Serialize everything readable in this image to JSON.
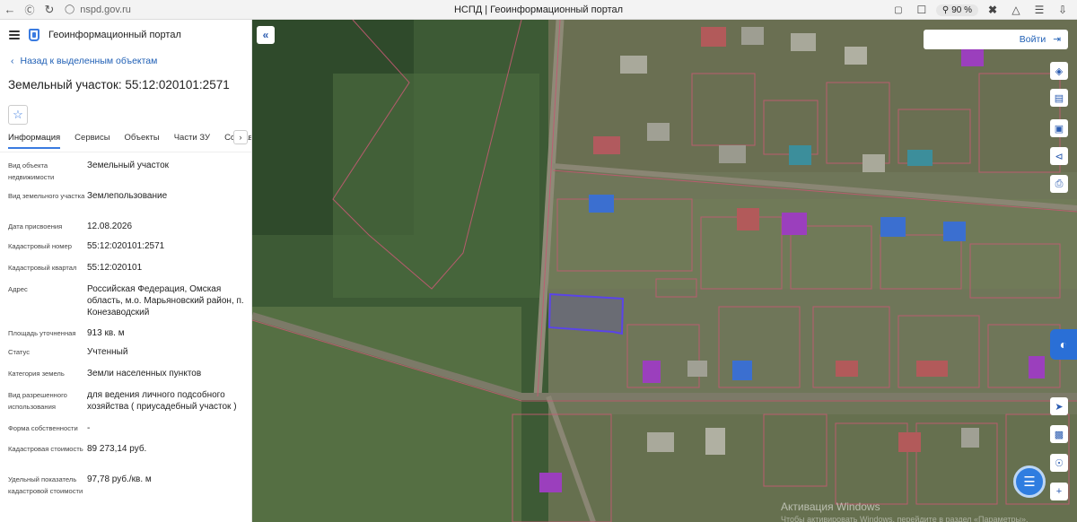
{
  "browser": {
    "url": "nspd.gov.ru",
    "tab_title": "НСПД | Геоинформационный портал",
    "zoom": "90 %"
  },
  "panel": {
    "header_title": "Геоинформационный портал",
    "back_link": "Назад к выделенным объектам",
    "object_title": "Земельный участок: 55:12:020101:2571",
    "tabs": [
      "Информация",
      "Сервисы",
      "Объекты",
      "Части ЗУ",
      "Состав"
    ],
    "properties": [
      {
        "label": "Вид объекта недвижимости",
        "value": "Земельный участок"
      },
      {
        "label": "Вид земельного участка",
        "value": "Землепользование"
      },
      {
        "label": "Дата присвоения",
        "value": "12.08.2026"
      },
      {
        "label": "Кадастровый номер",
        "value": "55:12:020101:2571"
      },
      {
        "label": "Кадастровый квартал",
        "value": "55:12:020101"
      },
      {
        "label": "Адрес",
        "value": "Российская Федерация, Омская область, м.о. Марьяновский район, п. Конезаводский"
      },
      {
        "label": "Площадь уточненная",
        "value": "913 кв. м"
      },
      {
        "label": "Статус",
        "value": "Учтенный"
      },
      {
        "label": "Категория земель",
        "value": "Земли населенных пунктов"
      },
      {
        "label": "Вид разрешенного использования",
        "value": "для ведения личного подсобного хозяйства ( приусадебный участок )"
      },
      {
        "label": "Форма собственности",
        "value": "-"
      },
      {
        "label": "Кадастровая стоимость",
        "value": "89 273,14 руб."
      },
      {
        "label": "Удельный показатель кадастровой стоимости",
        "value": "97,78 руб./кв. м"
      }
    ]
  },
  "map": {
    "login_label": "Войти",
    "watermark": "Активация Windows",
    "watermark_sub": "Чтобы активировать Windows, перейдите в раздел «Параметры»."
  },
  "icons": {
    "back": "arrow-left-icon",
    "refresh": "refresh-icon",
    "lock": "lock-icon",
    "bookmark": "bookmark-icon",
    "search": "search-icon",
    "download": "download-icon",
    "star": "star-icon",
    "login": "login-icon"
  }
}
